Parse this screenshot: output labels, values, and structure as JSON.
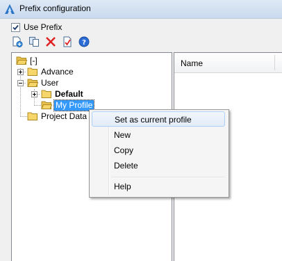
{
  "window": {
    "title": "Prefix configuration"
  },
  "use_prefix": {
    "label": "Use Prefix",
    "checked": true
  },
  "toolbar": {
    "buttons": [
      "new-profile-icon",
      "copy-icon",
      "delete-icon",
      "set-current-icon",
      "help-icon"
    ]
  },
  "tree": {
    "root": "[-]",
    "advance": "Advance",
    "user": "User",
    "default": "Default",
    "my_profile": "My Profile",
    "project_data": "Project Data"
  },
  "list": {
    "column_name": "Name"
  },
  "context_menu": {
    "set_current": "Set as current profile",
    "new": "New",
    "copy": "Copy",
    "delete": "Delete",
    "help": "Help"
  },
  "colors": {
    "selection": "#3399ff",
    "folder": "#f6d56b",
    "delete_red": "#e02020",
    "help_blue": "#2a6bd6"
  }
}
